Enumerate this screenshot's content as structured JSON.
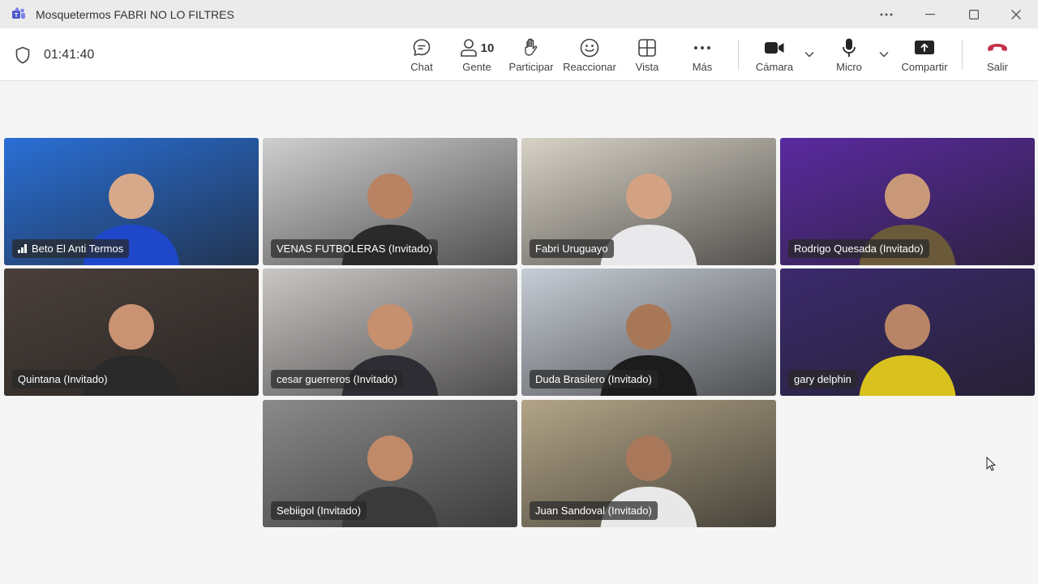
{
  "window": {
    "title": "Mosquetermos FABRI NO LO FILTRES"
  },
  "meeting": {
    "elapsed": "01:41:40",
    "people_count": "10"
  },
  "toolbar": {
    "chat": "Chat",
    "people": "Gente",
    "raise_hand": "Participar",
    "react": "Reaccionar",
    "view": "Vista",
    "more": "Más",
    "camera": "Cámara",
    "mic": "Micro",
    "share": "Compartir",
    "leave": "Salir"
  },
  "colors": {
    "accent": "#7b83eb",
    "leave": "#c4314b"
  },
  "participants": [
    {
      "name": "Beto El Anti Termos",
      "bg": "#2a6fd6",
      "shirt": "#1f47c9",
      "speaking_signal": true
    },
    {
      "name": "VENAS FUTBOLERAS (Invitado)",
      "bg": "#cfcfcf",
      "shirt": "#2a2a2a"
    },
    {
      "name": "Fabri Uruguayo",
      "bg": "#d8d2c6",
      "shirt": "#e9e9ec"
    },
    {
      "name": "Rodrigo Quesada (Invitado)",
      "bg": "#5a2aa0",
      "shirt": "#6b5a3a"
    },
    {
      "name": "Quintana (Invitado)",
      "bg": "#4a3f3a",
      "shirt": "#2a2a2a",
      "selected": true
    },
    {
      "name": "cesar guerreros (Invitado)",
      "bg": "#c9c6c4",
      "shirt": "#2d2d33"
    },
    {
      "name": "Duda Brasilero (Invitado)",
      "bg": "#c7cdd6",
      "shirt": "#1c1c1c"
    },
    {
      "name": "gary delphin",
      "bg": "#3b2a6e",
      "shirt": "#d9c21e",
      "selected": true
    },
    {
      "name": "Sebiigol (Invitado)",
      "bg": "#8a8a8a",
      "shirt": "#3a3a3a"
    },
    {
      "name": "Juan Sandoval (Invitado)",
      "bg": "#b2a486",
      "shirt": "#e8e8e8"
    }
  ]
}
